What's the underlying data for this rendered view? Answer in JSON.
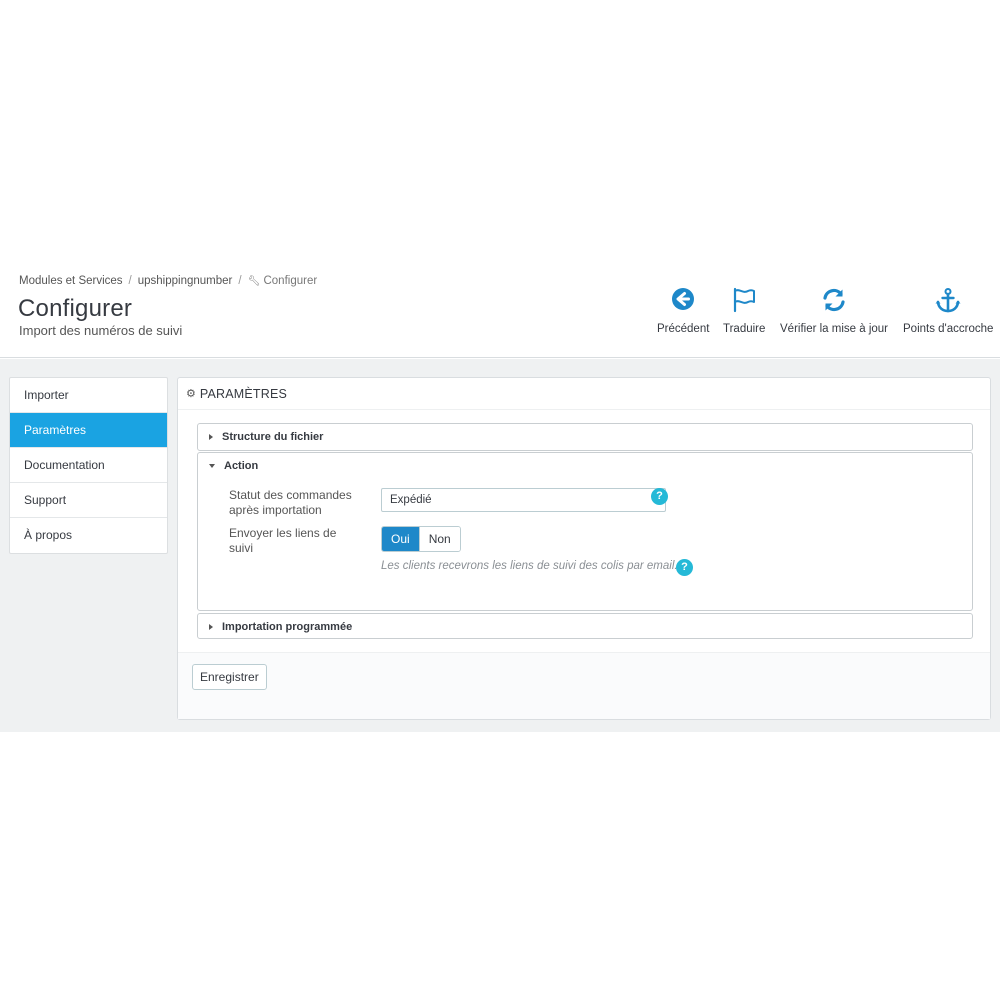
{
  "breadcrumb": {
    "items": [
      "Modules et Services",
      "upshippingnumber",
      "Configurer"
    ],
    "separator": "/"
  },
  "header": {
    "title": "Configurer",
    "subtitle": "Import des numéros de suivi"
  },
  "toolbar": {
    "back_label": "Précédent",
    "translate_label": "Traduire",
    "update_label": "Vérifier la mise à jour",
    "hooks_label": "Points d'accroche"
  },
  "sidebar": {
    "items": [
      {
        "label": "Importer",
        "active": false
      },
      {
        "label": "Paramètres",
        "active": true
      },
      {
        "label": "Documentation",
        "active": false
      },
      {
        "label": "Support",
        "active": false
      },
      {
        "label": "À propos",
        "active": false
      }
    ]
  },
  "panel": {
    "heading": "PARAMÈTRES",
    "sections": {
      "file_structure": "Structure du fichier",
      "action": "Action",
      "scheduled_import": "Importation programmée"
    },
    "form": {
      "order_status_label": "Statut des commandes après importation",
      "order_status_value": "Expédié",
      "send_links_label": "Envoyer les liens de suivi",
      "yes_label": "Oui",
      "no_label": "Non",
      "send_links_value": "Oui",
      "send_links_hint": "Les clients recevrons les liens de suivi des colis par email.",
      "help_glyph": "?"
    },
    "save_label": "Enregistrer"
  },
  "colors": {
    "accent": "#1aa3e2",
    "toolbar_icon": "#1e88c9",
    "help": "#25b9d7",
    "switch_on": "#1e88c9"
  },
  "icons": {
    "back": "arrow-circle-left-icon",
    "translate": "flag-icon",
    "update": "refresh-icon",
    "hooks": "anchor-icon",
    "settings": "cogs-icon",
    "breadcrumb_current": "wrench-icon"
  }
}
